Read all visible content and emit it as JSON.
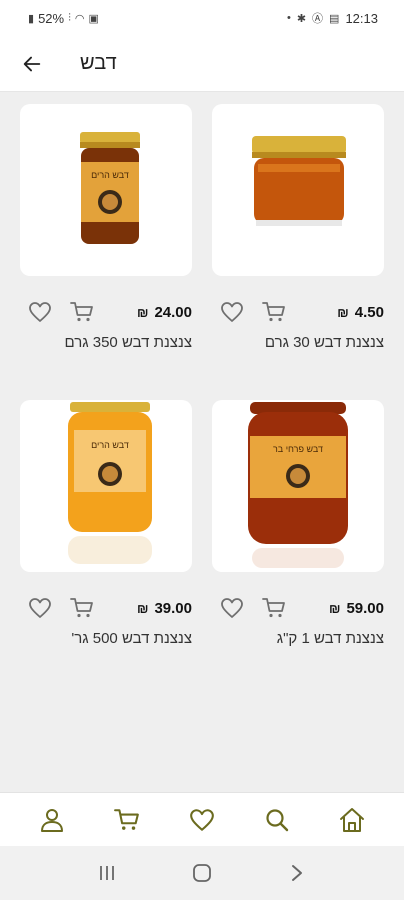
{
  "status_bar": {
    "battery": "52%",
    "time": "12:13"
  },
  "header": {
    "title": "דבש"
  },
  "products": [
    {
      "name": "צנצנת דבש 350 גרם",
      "price": "24.00",
      "currency": "₪"
    },
    {
      "name": "צנצנת דבש 30 גרם",
      "price": "4.50",
      "currency": "₪"
    },
    {
      "name": "צנצנת דבש 500 גר'",
      "price": "39.00",
      "currency": "₪"
    },
    {
      "name": "צנצנת דבש 1 ק\"ג",
      "price": "59.00",
      "currency": "₪"
    }
  ],
  "jar_labels": {
    "harim": "דבש הרים",
    "prachim": "דבש פרחי בר"
  },
  "colors": {
    "accent": "#6b6b1f",
    "honey": "#c96a12",
    "lid": "#d9b23a"
  },
  "bottom_nav": [
    "user-icon",
    "cart-icon",
    "heart-icon",
    "search-icon",
    "home-icon"
  ]
}
